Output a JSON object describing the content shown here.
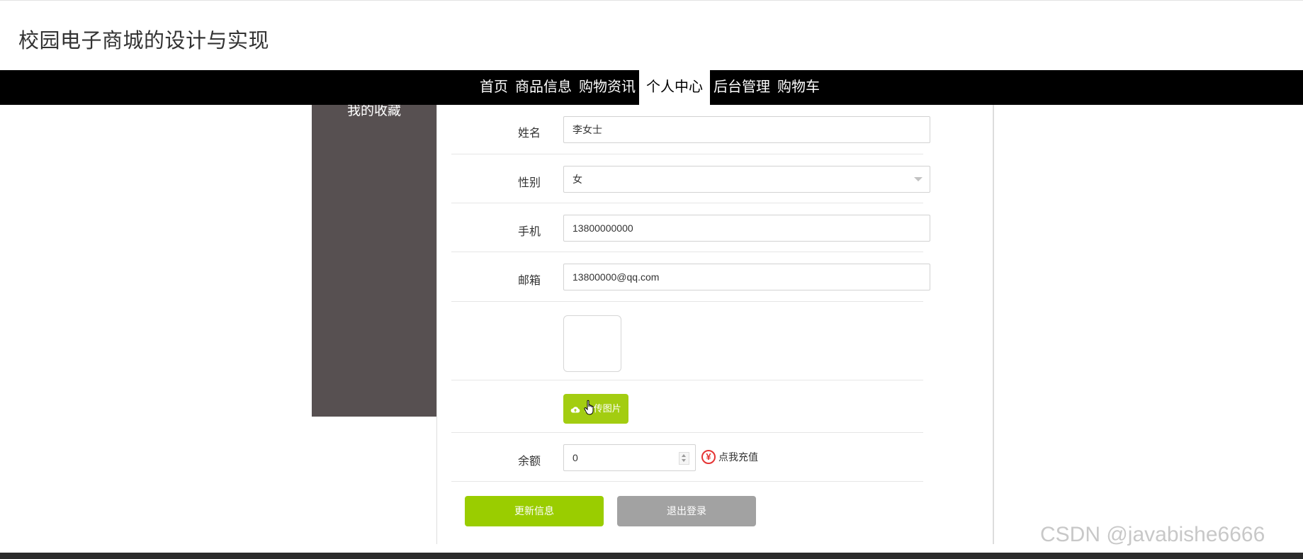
{
  "site": {
    "title": "校园电子商城的设计与实现"
  },
  "nav": {
    "items": [
      {
        "label": "首页"
      },
      {
        "label": "商品信息"
      },
      {
        "label": "购物资讯"
      },
      {
        "label": "个人中心"
      },
      {
        "label": "后台管理"
      },
      {
        "label": "购物车"
      }
    ],
    "active": "个人中心"
  },
  "sidebar": {
    "items": [
      {
        "label": "我的收藏"
      }
    ]
  },
  "form": {
    "name": {
      "label": "姓名",
      "value": "李女士"
    },
    "gender": {
      "label": "性别",
      "value": "女"
    },
    "phone": {
      "label": "手机",
      "value": "13800000000"
    },
    "email": {
      "label": "邮箱",
      "value": "13800000@qq.com"
    },
    "upload": {
      "label": "上传图片"
    },
    "balance": {
      "label": "余额",
      "value": "0"
    },
    "recharge": {
      "label": "点我充值",
      "icon": "¥"
    }
  },
  "actions": {
    "update_label": "更新信息",
    "logout_label": "退出登录"
  },
  "watermark": "CSDN @javabishe6666",
  "colors": {
    "accent_green": "#9acd00",
    "nav_bg": "#000000",
    "sidebar_bg": "#575051",
    "logout_gray": "#a2a2a2"
  }
}
